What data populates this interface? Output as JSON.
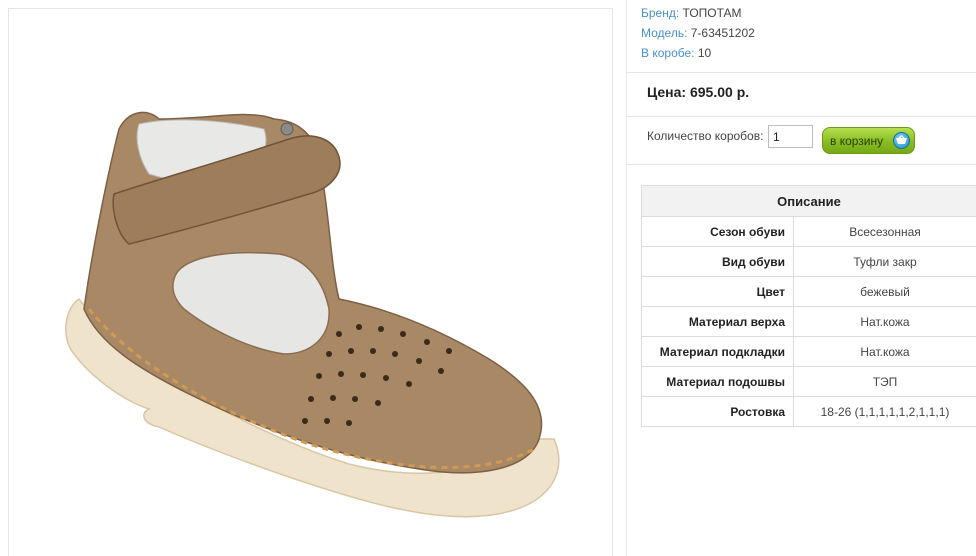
{
  "product": {
    "brand_label": "Бренд:",
    "brand_value": "ТОПОТАМ",
    "model_label": "Модель:",
    "model_value": "7-63451202",
    "box_label": "В коробе:",
    "box_value": "10",
    "price": "Цена: 695.00 р.",
    "image_icon": "shoe-photo"
  },
  "order": {
    "qty_label": "Количество коробов:",
    "qty_value": "1",
    "cart_button_label": "в корзину",
    "cart_icon": "basket-icon"
  },
  "description": {
    "title": "Описание",
    "rows": [
      {
        "key": "Сезон обуви",
        "value": "Всесезонная"
      },
      {
        "key": "Вид обуви",
        "value": "Туфли закр"
      },
      {
        "key": "Цвет",
        "value": "бежевый"
      },
      {
        "key": "Материал верха",
        "value": "Нат.кожа"
      },
      {
        "key": "Материал подкладки",
        "value": "Нат.кожа"
      },
      {
        "key": "Материал подошвы",
        "value": "ТЭП"
      },
      {
        "key": "Ростовка",
        "value": "18-26 (1,1,1,1,1,2,1,1,1)"
      }
    ]
  },
  "colors": {
    "link_blue": "#4a90c8",
    "button_green": "#87bd22",
    "leather": "#a0805f",
    "sole": "#eee0c8"
  }
}
